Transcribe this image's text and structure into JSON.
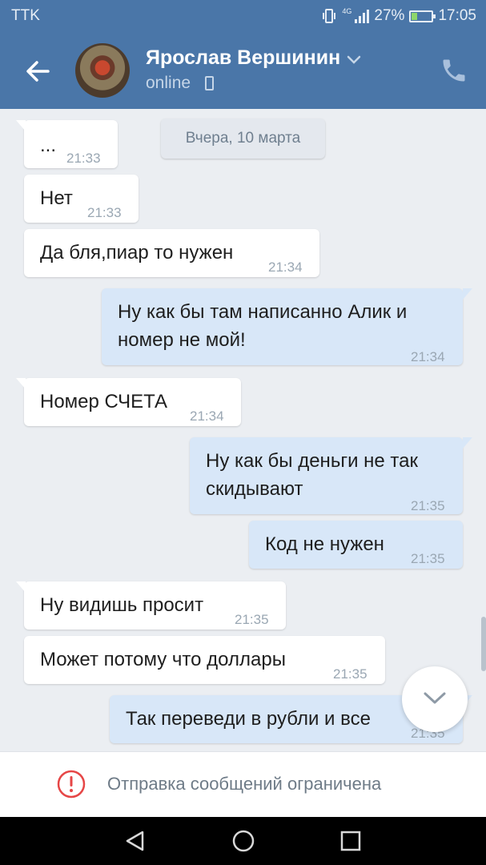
{
  "status_bar": {
    "carrier": "TTK",
    "network": "4G",
    "battery_percent": "27%",
    "battery_level": 0.27,
    "time": "17:05"
  },
  "header": {
    "contact_name": "Ярослав Вершинин",
    "status": "online"
  },
  "chat": {
    "date_label": "Вчера, 10 марта",
    "messages": [
      {
        "direction": "in",
        "text": "...",
        "time": "21:33"
      },
      {
        "direction": "in",
        "text": "Нет",
        "time": "21:33"
      },
      {
        "direction": "in",
        "text": "Да бля,пиар то нужен",
        "time": "21:34"
      },
      {
        "direction": "out",
        "text": "Ну как бы там написанно Алик и номер не мой!",
        "time": "21:34"
      },
      {
        "direction": "in",
        "text": "Номер СЧЕТА",
        "time": "21:34"
      },
      {
        "direction": "out",
        "text": "Ну как бы деньги не так скидывают",
        "time": "21:35"
      },
      {
        "direction": "out",
        "text": "Код не нужен",
        "time": "21:35"
      },
      {
        "direction": "in",
        "text": "Ну видишь просит",
        "time": "21:35"
      },
      {
        "direction": "in",
        "text": "Может потому что доллары",
        "time": "21:35"
      },
      {
        "direction": "out",
        "text": "Так переведи в рубли и все",
        "time": "21:35"
      }
    ]
  },
  "notice": {
    "text": "Отправка сообщений ограничена"
  },
  "colors": {
    "header": "#4a76a8",
    "incoming_bubble": "#ffffff",
    "outgoing_bubble": "#d8e7f8",
    "chat_background": "#ebeef2",
    "warning_red": "#e64646"
  },
  "icons": [
    "back-arrow-icon",
    "chevron-down-icon",
    "mobile-phone-icon",
    "phone-icon",
    "scroll-down-icon",
    "warning-icon",
    "nav-back-icon",
    "nav-home-icon",
    "nav-recent-icon"
  ]
}
